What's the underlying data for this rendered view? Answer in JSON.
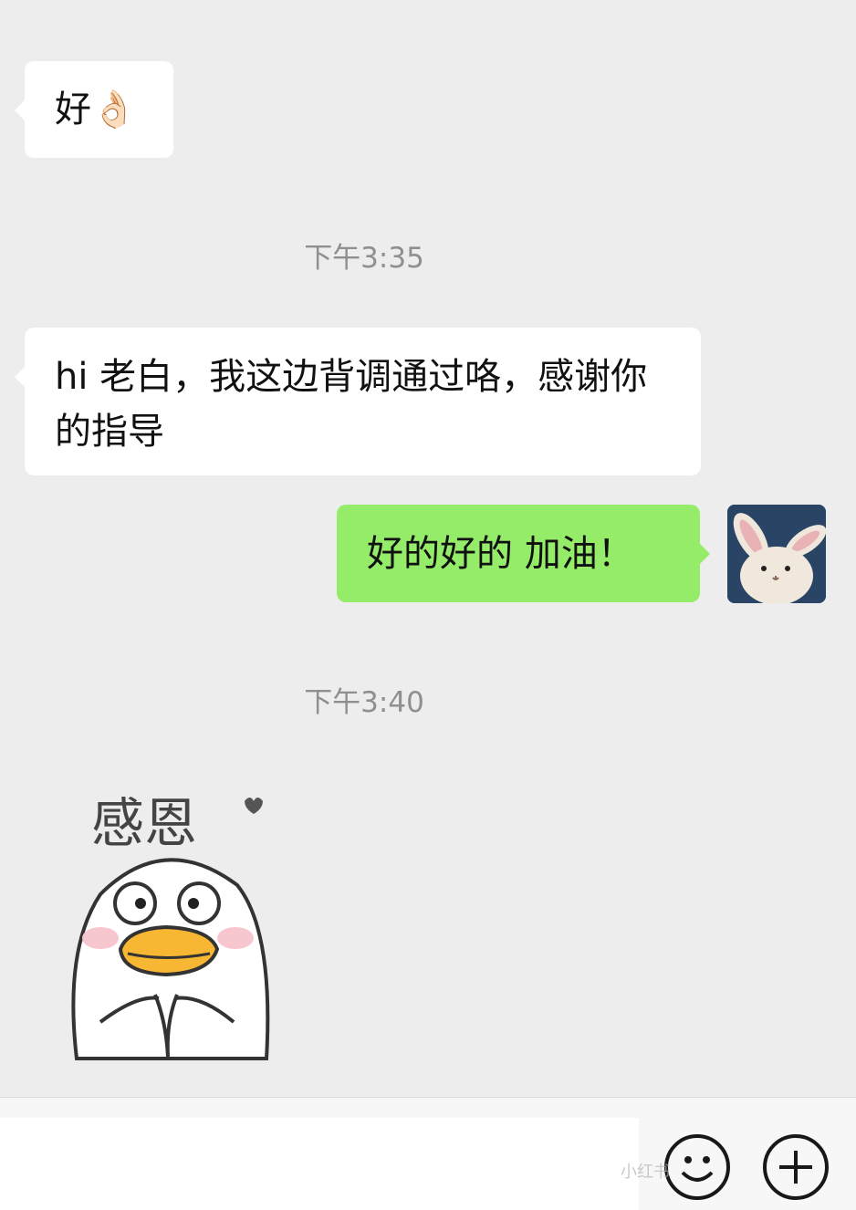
{
  "messages": [
    {
      "side": "in",
      "text": "好👌🏻"
    },
    {
      "side": "in",
      "text": "hi 老白，我这边背调通过咯，感谢你的指导"
    },
    {
      "side": "out",
      "text": "好的好的 加油！"
    }
  ],
  "timestamps": [
    "下午3:35",
    "下午3:40"
  ],
  "sticker": {
    "text": "感恩"
  },
  "watermark": "小红书",
  "colors": {
    "background": "#ededed",
    "incoming": "#ffffff",
    "outgoing": "#95ec69",
    "timestamp": "#8f8f8f"
  },
  "icons": {
    "emoji": "smile-icon",
    "more": "plus-icon"
  }
}
